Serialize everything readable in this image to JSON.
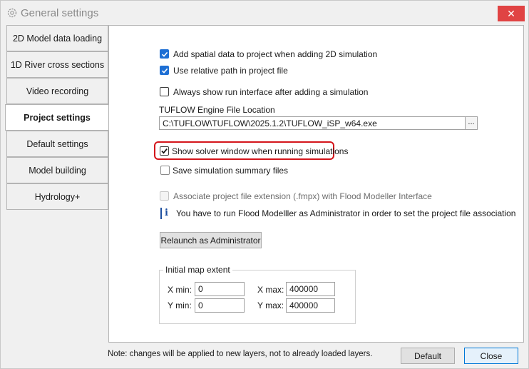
{
  "window": {
    "title": "General settings",
    "close_symbol": "✕"
  },
  "sidebar": {
    "tabs": [
      {
        "label": "2D Model data loading",
        "active": false
      },
      {
        "label": "1D River cross sections",
        "active": false
      },
      {
        "label": "Video recording",
        "active": false
      },
      {
        "label": "Project settings",
        "active": true
      },
      {
        "label": "Default settings",
        "active": false
      },
      {
        "label": "Model building",
        "active": false
      },
      {
        "label": "Hydrology+",
        "active": false
      }
    ]
  },
  "project": {
    "add_spatial_data": {
      "label": "Add spatial data to project when adding 2D simulation",
      "checked": true
    },
    "relative_path": {
      "label": "Use relative path in project file",
      "checked": true
    },
    "always_show_run": {
      "label": "Always show run interface after adding a simulation",
      "checked": false
    },
    "engine_location_label": "TUFLOW Engine File Location",
    "engine_path": "C:\\TUFLOW\\TUFLOW\\2025.1.2\\TUFLOW_iSP_w64.exe",
    "browse_label": "...",
    "show_solver": {
      "label": "Show solver window when running simulations",
      "checked": true
    },
    "save_summary": {
      "label": "Save simulation summary files",
      "checked": false
    },
    "associate_ext": {
      "label": "Associate project file extension (.fmpx) with Flood Modeller Interface",
      "checked": false,
      "enabled": false
    },
    "info_icon": "i",
    "info_text": "You have to run Flood Modelller as Administrator in order to set the project file association",
    "relaunch_label": "Relaunch as Administrator",
    "map_extent": {
      "title": "Initial map extent",
      "xmin_label": "X min:",
      "xmin": "0",
      "xmax_label": "X max:",
      "xmax": "400000",
      "ymin_label": "Y min:",
      "ymin": "0",
      "ymax_label": "Y max:",
      "ymax": "400000"
    }
  },
  "footer": {
    "note": "Note: changes will be applied to new layers, not to already loaded layers.",
    "default_label": "Default",
    "close_label": "Close"
  },
  "colors": {
    "accent": "#1e6fd4",
    "highlight": "#d4151b",
    "close": "#e04343"
  }
}
